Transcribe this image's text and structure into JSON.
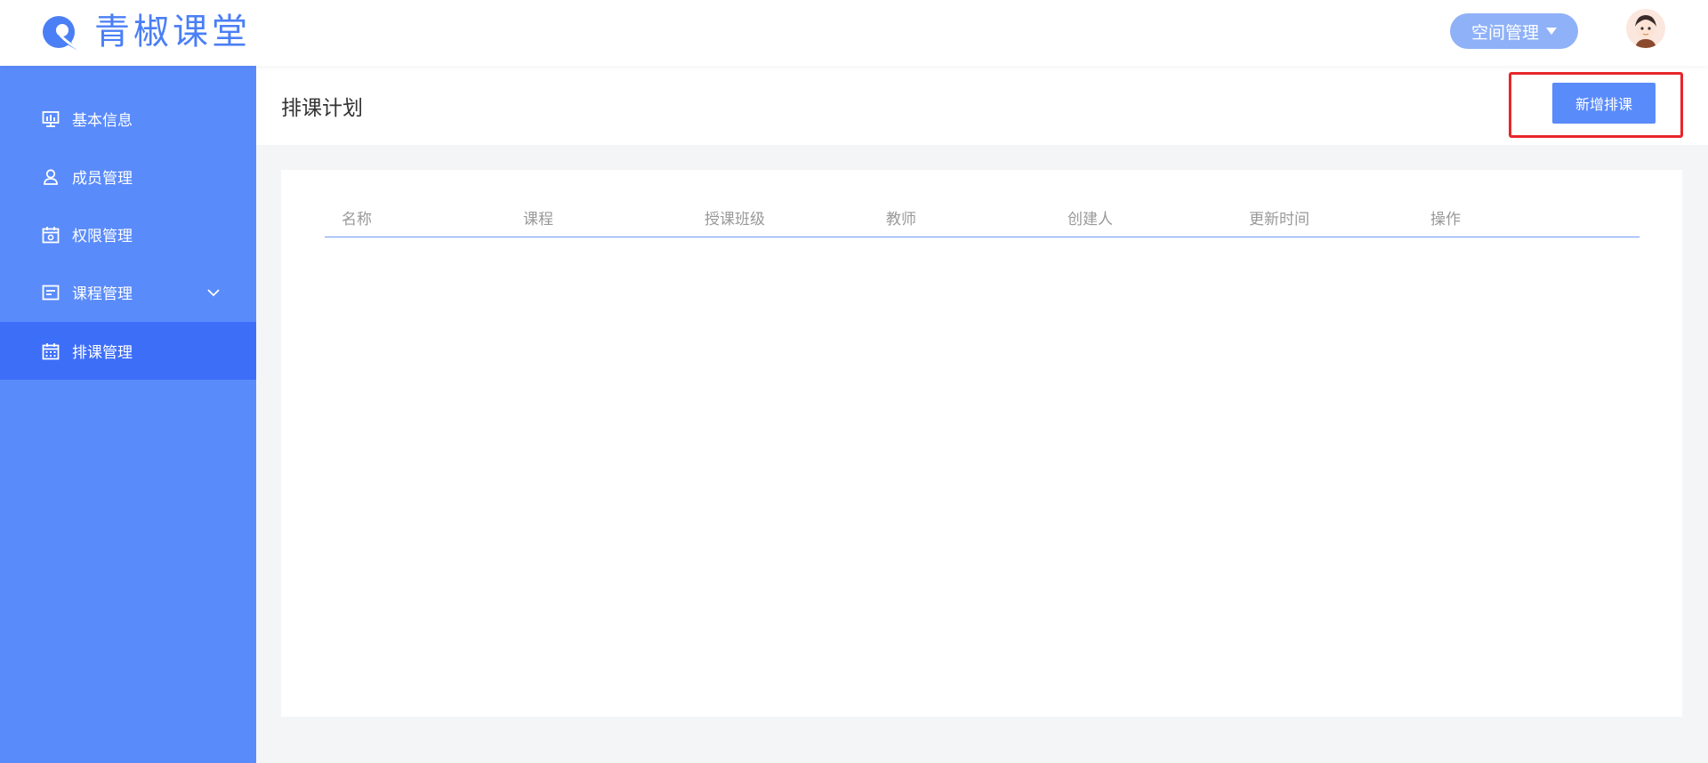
{
  "brand": {
    "name": "青椒课堂",
    "color": "#4a7ff5"
  },
  "header": {
    "space_button": {
      "label": "空间管理",
      "icon": "caret-down-icon"
    },
    "avatar": {
      "icon": "user-avatar"
    }
  },
  "sidebar": {
    "items": [
      {
        "label": "基本信息",
        "icon": "chart-board-icon",
        "active": false
      },
      {
        "label": "成员管理",
        "icon": "user-icon",
        "active": false
      },
      {
        "label": "权限管理",
        "icon": "calendar-gear-icon",
        "active": false
      },
      {
        "label": "课程管理",
        "icon": "document-icon",
        "active": false,
        "expandable": true
      },
      {
        "label": "排课管理",
        "icon": "calendar-grid-icon",
        "active": true
      }
    ]
  },
  "main": {
    "title": "排课计划",
    "add_button": "新增排课",
    "table": {
      "columns": [
        "名称",
        "课程",
        "授课班级",
        "教师",
        "创建人",
        "更新时间",
        "操作"
      ],
      "rows": []
    }
  },
  "colors": {
    "sidebar": "#5a8bfb",
    "sidebar_active": "#3d6ef8",
    "primary_button": "#5a8bfb",
    "highlight": "#e8262a"
  }
}
